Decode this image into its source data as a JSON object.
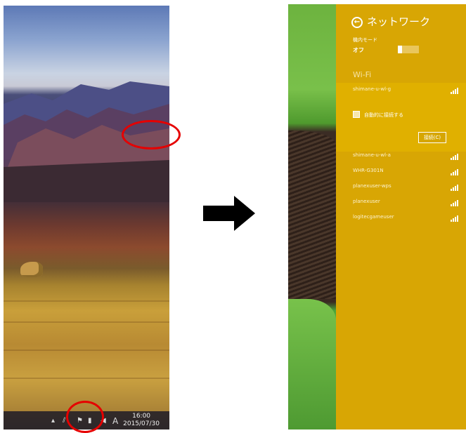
{
  "left": {
    "taskbar": {
      "time": "16:00",
      "date": "2015/07/30",
      "ime_indicator": "A",
      "tray_icons": [
        "chevron-up-icon",
        "network-icon",
        "flag-icon",
        "power-icon",
        "volume-icon"
      ]
    },
    "highlight_color": "#e50000"
  },
  "right": {
    "title": "ネットワーク",
    "airplane_mode": {
      "label": "機内モード",
      "state": "オフ",
      "on": false
    },
    "wifi_heading": "Wi-Fi",
    "selected_network": {
      "name": "shimane-u-wl-g",
      "auto_connect_label": "自動的に接続する",
      "connect_label": "接続(C)"
    },
    "networks": [
      {
        "name": "shimane-u-wl-a"
      },
      {
        "name": "WHR-G301N"
      },
      {
        "name": "planexuser-wps"
      },
      {
        "name": "planexuser"
      },
      {
        "name": "logitecgameuser"
      }
    ],
    "accent_color": "#d8a604"
  }
}
